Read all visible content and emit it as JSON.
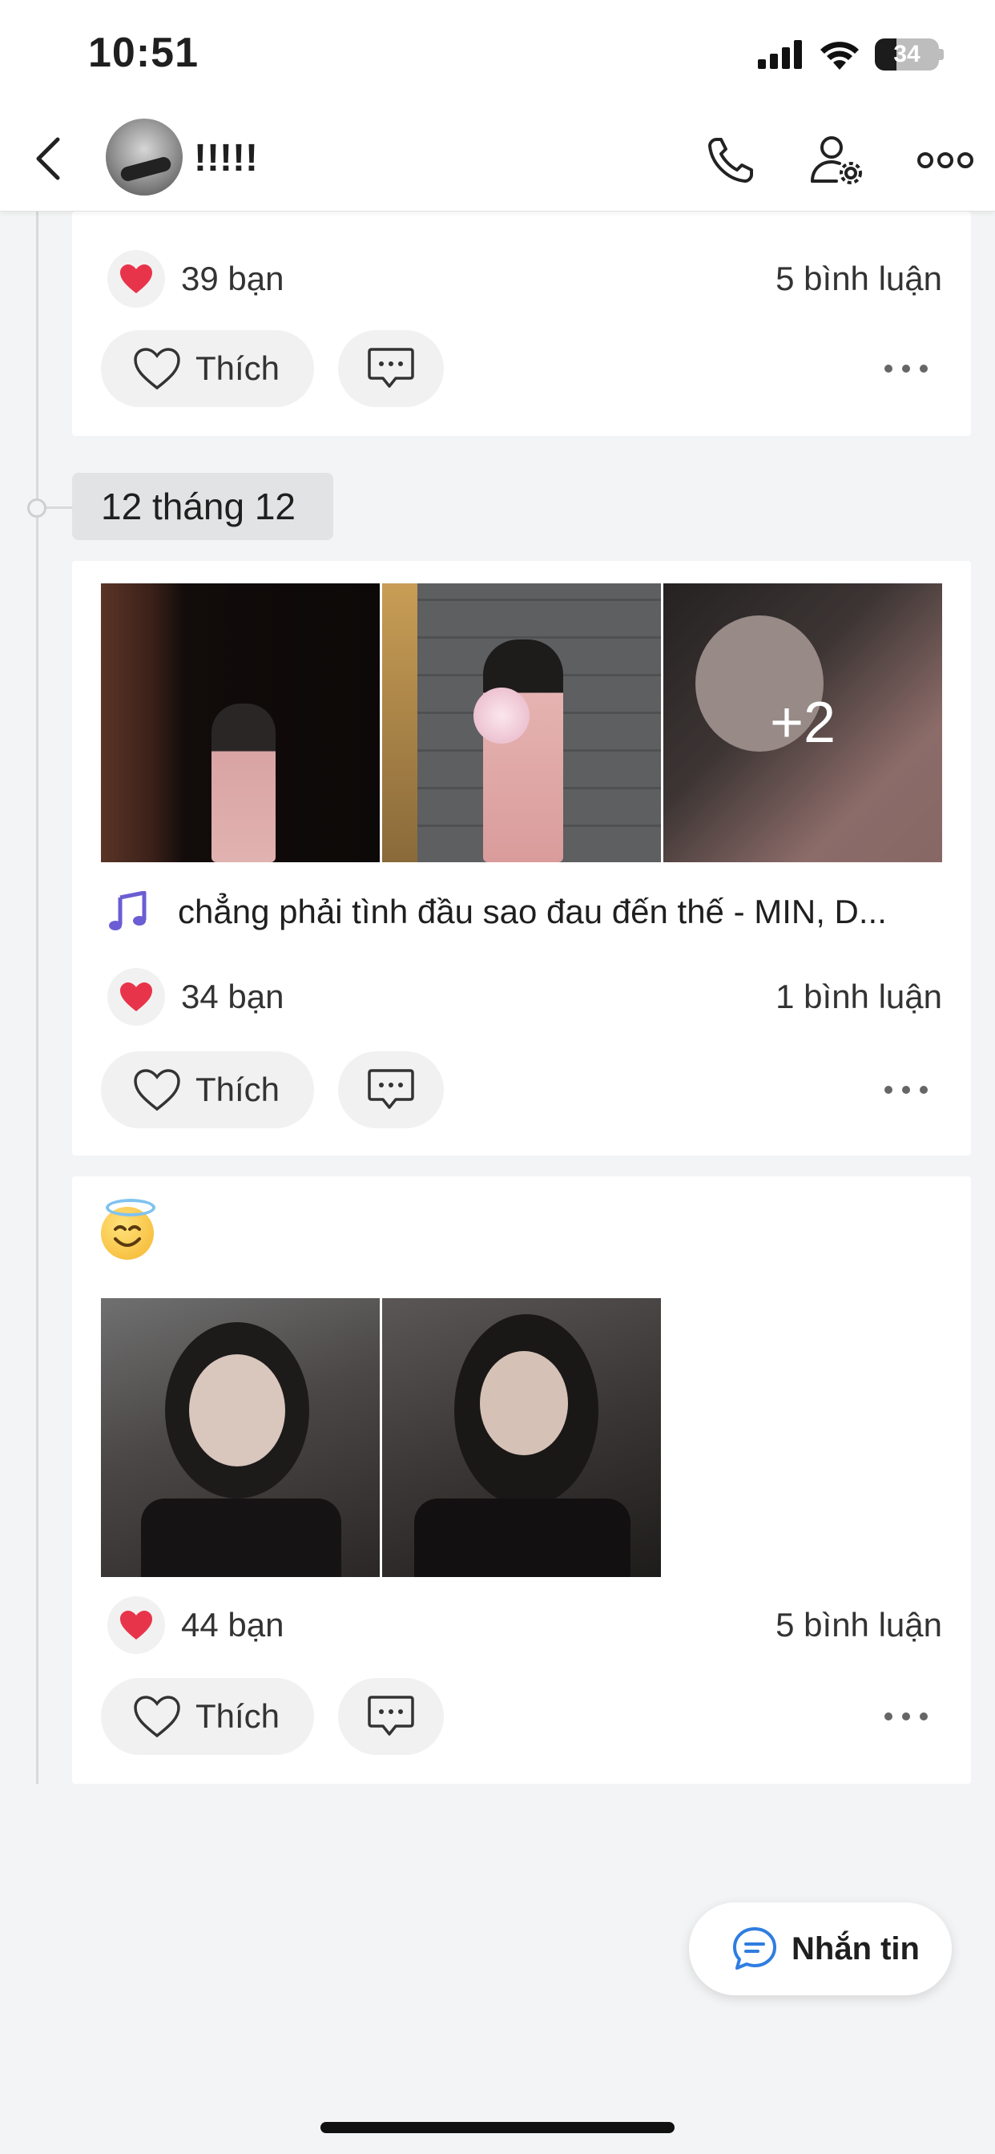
{
  "status_bar": {
    "time": "10:51",
    "battery": "34",
    "battery_level": 0.34
  },
  "header": {
    "name": "!!!!!",
    "icons": {
      "back": "chevron-left-icon",
      "call": "phone-icon",
      "settings": "user-gear-icon",
      "more": "more-horizontal-icon"
    }
  },
  "posts": [
    {
      "reactions": "39 bạn",
      "comments": "5 bình luận",
      "like_label": "Thích"
    },
    {
      "date": "12 tháng 12",
      "extra_photos": "+2",
      "music": "chẳng phải tình đầu sao đau đến thế - MIN, D...",
      "reactions": "34 bạn",
      "comments": "1 bình luận",
      "like_label": "Thích"
    },
    {
      "caption_emoji": "smiling-face-with-halo",
      "reactions": "44 bạn",
      "comments": "5 bình luận",
      "like_label": "Thích"
    }
  ],
  "fab": {
    "label": "Nhắn tin"
  },
  "colors": {
    "heart": "#e8344a",
    "music_note": "#6b5dd3",
    "message_icon": "#2f7de1",
    "background": "#f3f4f5"
  }
}
